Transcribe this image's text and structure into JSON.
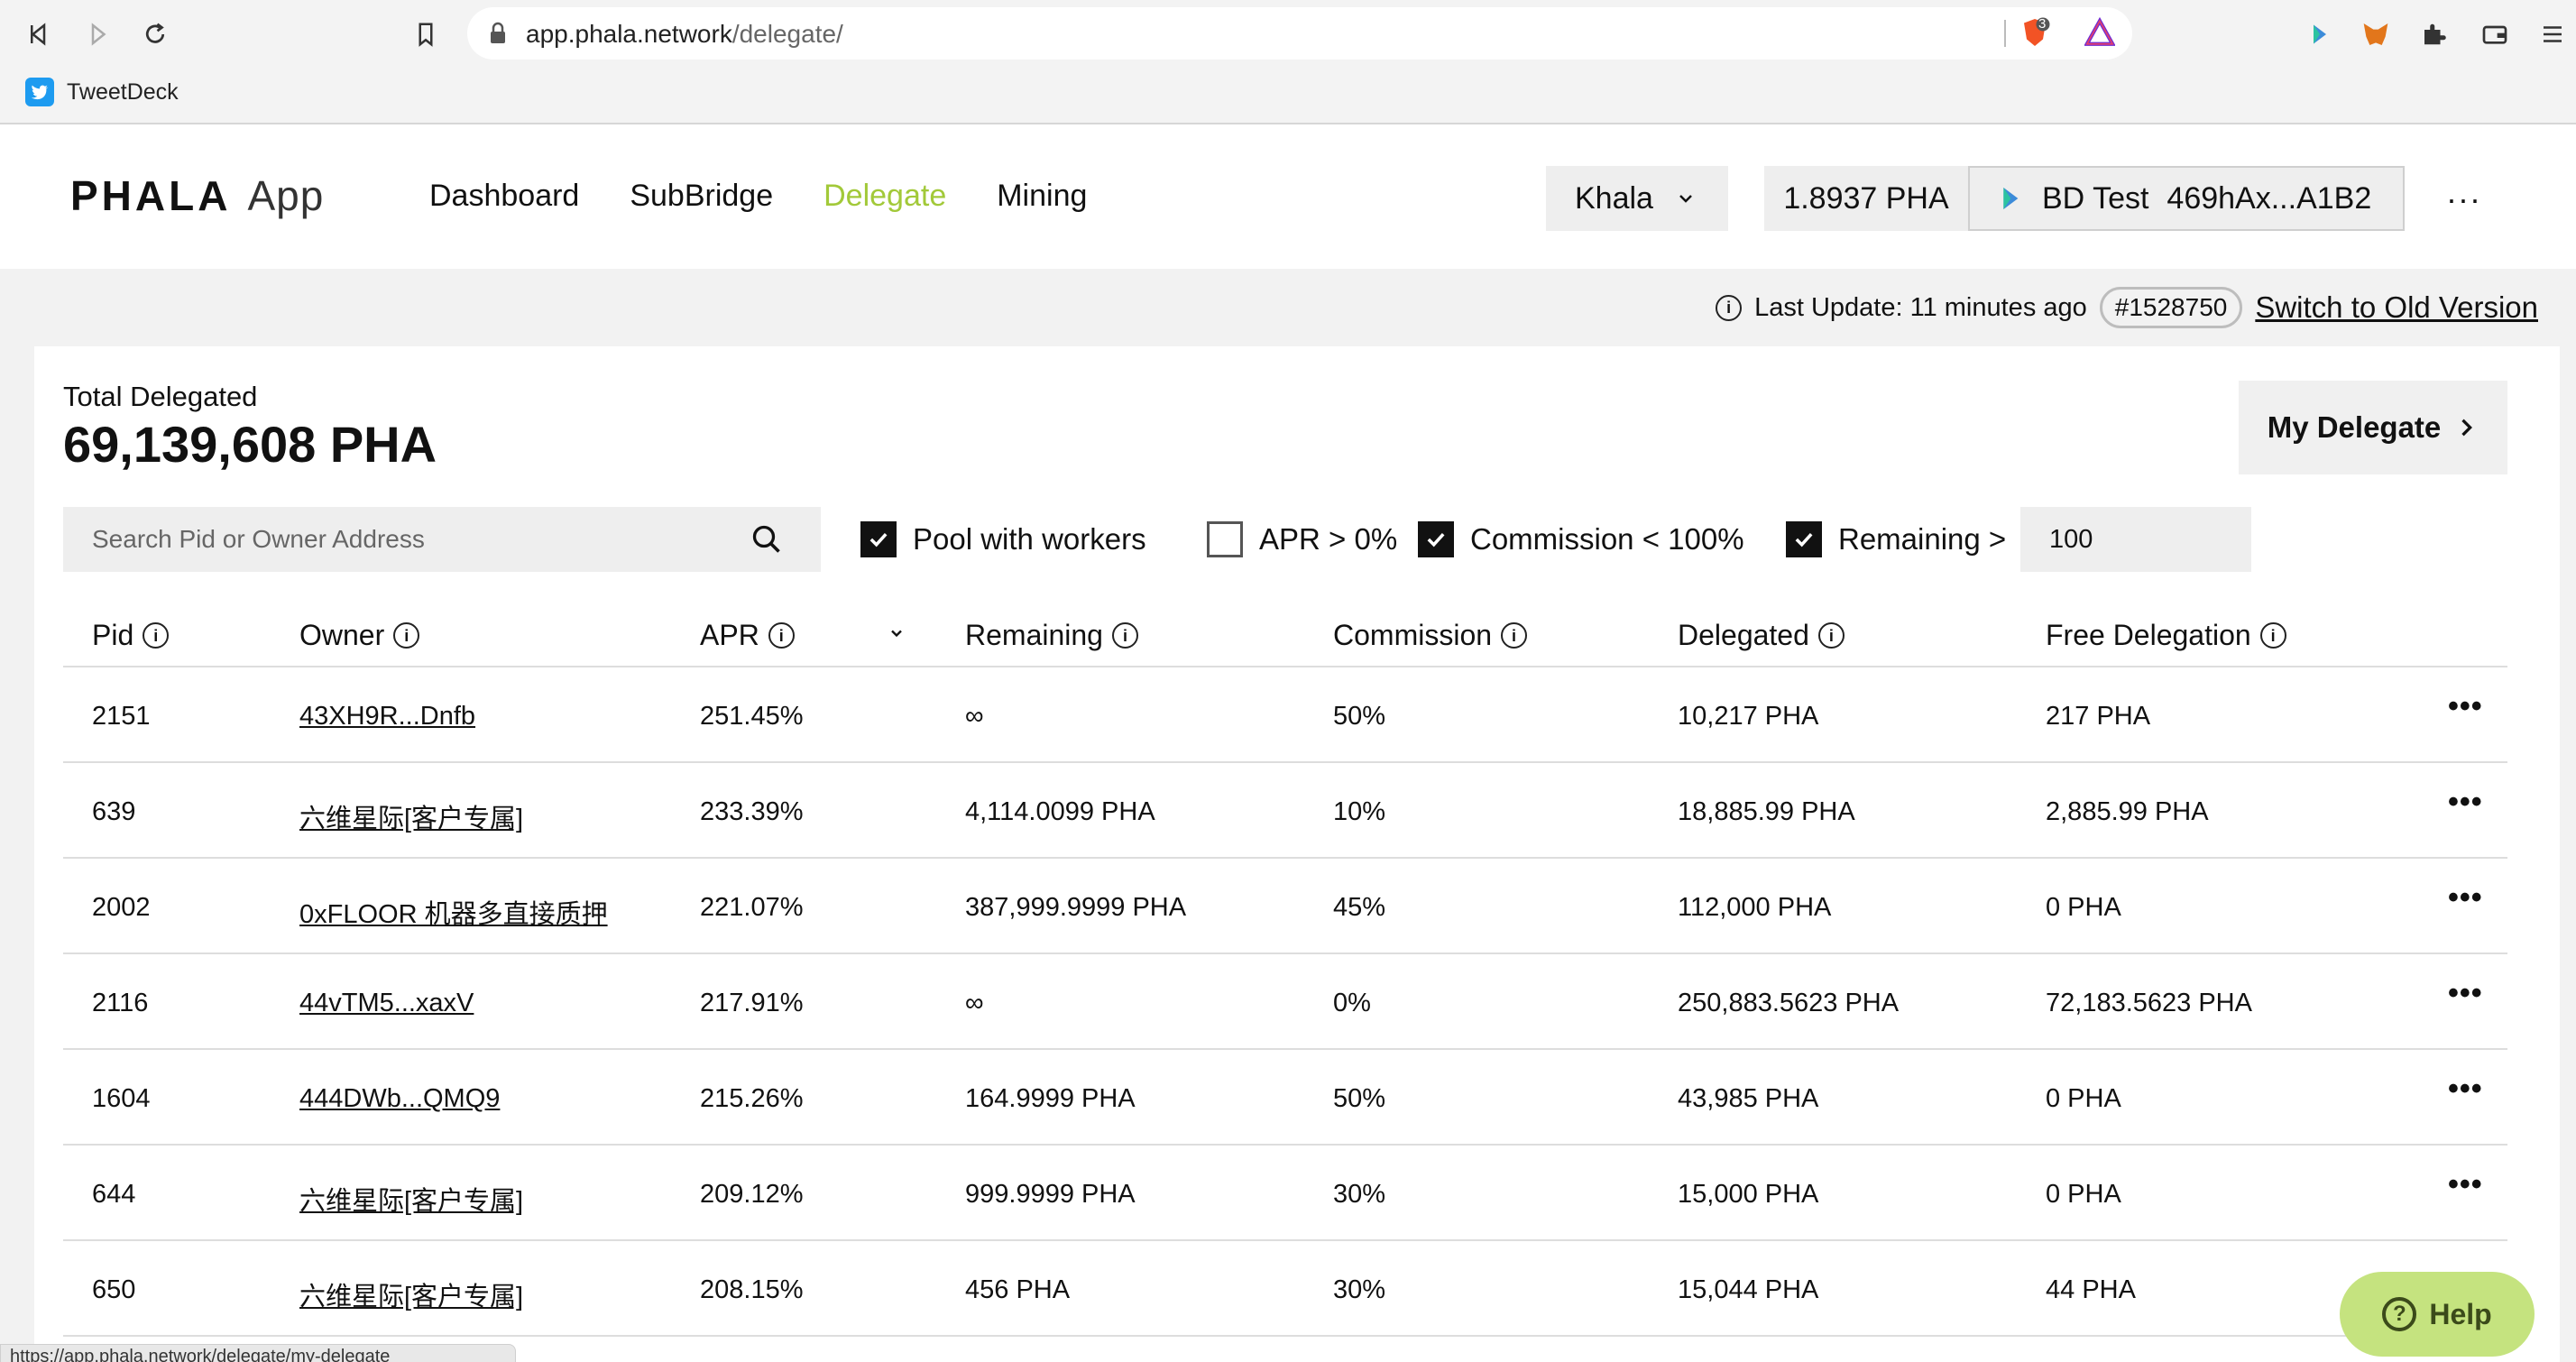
{
  "browser": {
    "url_host": "app.phala.network",
    "url_path": "/delegate/",
    "brave_badge": "3",
    "bookmark": "TweetDeck",
    "status_url": "https://app.phala.network/delegate/my-delegate"
  },
  "header": {
    "logo_main": "PHALA",
    "logo_app": "App",
    "nav": [
      "Dashboard",
      "SubBridge",
      "Delegate",
      "Mining"
    ],
    "active_nav": "Delegate",
    "network": "Khala",
    "balance": "1.8937 PHA",
    "account_name": "BD Test",
    "account_address": "469hAx...A1B2",
    "more": "···"
  },
  "status": {
    "last_update": "Last Update: 11 minutes ago",
    "block": "#1528750",
    "switch_link": "Switch to Old Version"
  },
  "summary": {
    "total_label": "Total Delegated",
    "total_value": "69,139,608 PHA",
    "my_delegate": "My Delegate"
  },
  "filters": {
    "search_placeholder": "Search Pid or Owner Address",
    "pool_with_workers": {
      "label": "Pool with workers",
      "checked": true
    },
    "apr_gt_zero": {
      "label": "APR > 0%",
      "checked": false
    },
    "commission_lt_100": {
      "label": "Commission < 100%",
      "checked": true
    },
    "remaining_gt": {
      "label": "Remaining >",
      "checked": true,
      "value": "100"
    }
  },
  "table": {
    "columns": [
      "Pid",
      "Owner",
      "APR",
      "Remaining",
      "Commission",
      "Delegated",
      "Free Delegation"
    ],
    "rows": [
      {
        "pid": "2151",
        "owner": "43XH9R...Dnfb",
        "apr": "251.45%",
        "remaining": "∞",
        "commission": "50%",
        "delegated": "10,217 PHA",
        "free": "217 PHA"
      },
      {
        "pid": "639",
        "owner": "六维星际[客户专属]",
        "apr": "233.39%",
        "remaining": "4,114.0099 PHA",
        "commission": "10%",
        "delegated": "18,885.99 PHA",
        "free": "2,885.99 PHA"
      },
      {
        "pid": "2002",
        "owner": "0xFLOOR 机器多直接质押",
        "apr": "221.07%",
        "remaining": "387,999.9999 PHA",
        "commission": "45%",
        "delegated": "112,000 PHA",
        "free": "0 PHA"
      },
      {
        "pid": "2116",
        "owner": "44vTM5...xaxV",
        "apr": "217.91%",
        "remaining": "∞",
        "commission": "0%",
        "delegated": "250,883.5623 PHA",
        "free": "72,183.5623 PHA"
      },
      {
        "pid": "1604",
        "owner": "444DWb...QMQ9",
        "apr": "215.26%",
        "remaining": "164.9999 PHA",
        "commission": "50%",
        "delegated": "43,985 PHA",
        "free": "0 PHA"
      },
      {
        "pid": "644",
        "owner": "六维星际[客户专属]",
        "apr": "209.12%",
        "remaining": "999.9999 PHA",
        "commission": "30%",
        "delegated": "15,000 PHA",
        "free": "0 PHA"
      },
      {
        "pid": "650",
        "owner": "六维星际[客户专属]",
        "apr": "208.15%",
        "remaining": "456 PHA",
        "commission": "30%",
        "delegated": "15,044 PHA",
        "free": "44 PHA"
      }
    ]
  },
  "help": {
    "label": "Help"
  },
  "colors": {
    "accent": "#a2c939",
    "help_bg": "#c5e37f",
    "page_bg": "#f2f2f2"
  }
}
